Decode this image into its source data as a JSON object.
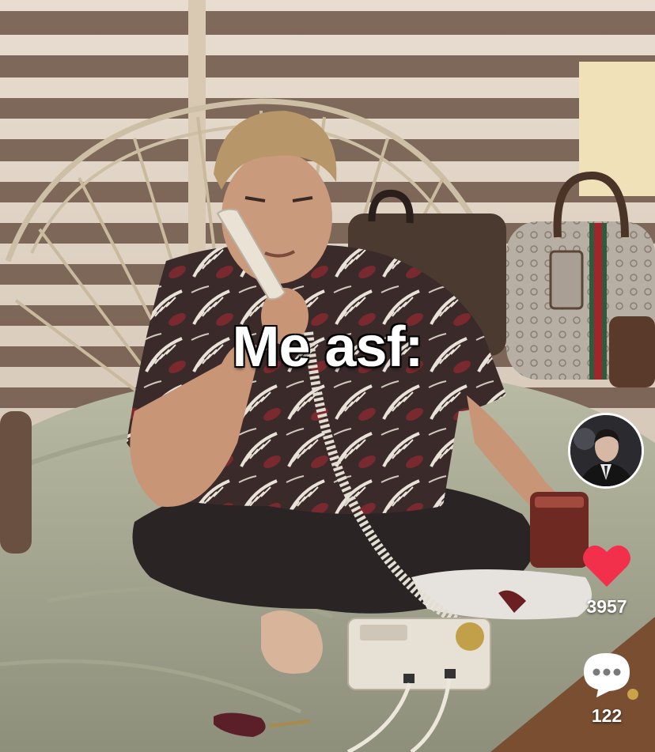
{
  "video": {
    "caption": "Me asf:"
  },
  "actions": {
    "like_count": "3957",
    "comment_count": "122",
    "icons": {
      "avatar": "creator-avatar",
      "like": "heart-icon",
      "comment": "comment-bubble-icon"
    },
    "colors": {
      "like": "#F2304B",
      "comment": "#FFFFFF"
    }
  }
}
